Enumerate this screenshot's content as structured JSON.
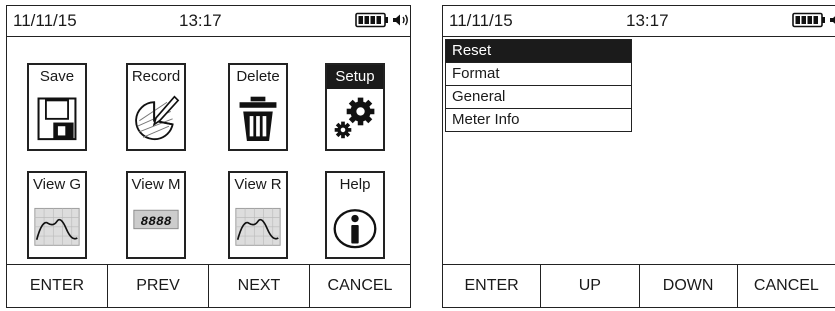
{
  "main_screen": {
    "status": {
      "date": "11/11/15",
      "time": "13:17",
      "battery_icon": "battery-full-icon",
      "speaker_icon": "speaker-icon"
    },
    "tiles": [
      {
        "label": "Save",
        "icon": "floppy-disk-icon"
      },
      {
        "label": "Record",
        "icon": "record-pen-icon"
      },
      {
        "label": "Delete",
        "icon": "trash-bin-icon"
      },
      {
        "label": "Setup",
        "icon": "gears-icon",
        "highlighted": true
      },
      {
        "label": "View G",
        "icon": "graph-wave-icon"
      },
      {
        "label": "View M",
        "icon": "numeric-display-icon",
        "display_text": "8888"
      },
      {
        "label": "View R",
        "icon": "graph-wave-icon"
      },
      {
        "label": "Help",
        "icon": "info-icon"
      }
    ],
    "softkeys": [
      "ENTER",
      "PREV",
      "NEXT",
      "CANCEL"
    ]
  },
  "setup_screen": {
    "status": {
      "date": "11/11/15",
      "time": "13:17",
      "battery_icon": "battery-full-icon",
      "speaker_icon": "speaker-icon"
    },
    "menu": [
      {
        "label": "Reset",
        "selected": true
      },
      {
        "label": "Format"
      },
      {
        "label": "General"
      },
      {
        "label": "Meter Info"
      }
    ],
    "softkeys": [
      "ENTER",
      "UP",
      "DOWN",
      "CANCEL"
    ]
  }
}
